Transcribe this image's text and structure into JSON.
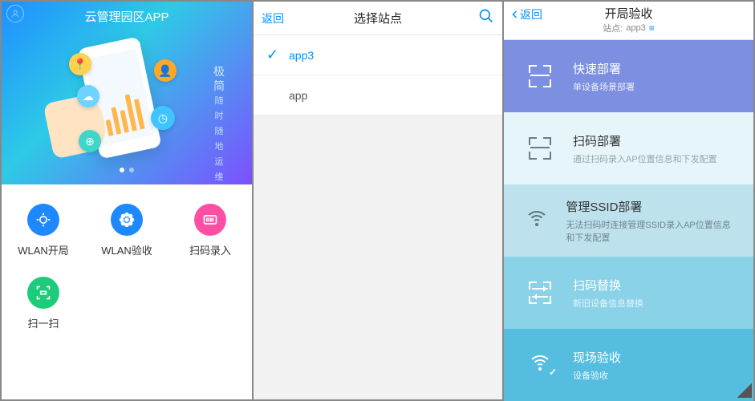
{
  "panel1": {
    "title": "云管理园区APP",
    "slogan_big": "极\n简",
    "slogan_small": "随\n时\n随\n地\n运\n维",
    "tiles": [
      {
        "label": "WLAN开局",
        "icon": "scan-icon",
        "color": "ic-blue"
      },
      {
        "label": "WLAN验收",
        "icon": "flower-icon",
        "color": "ic-blue2"
      },
      {
        "label": "扫码录入",
        "icon": "barcode-icon",
        "color": "ic-pink"
      },
      {
        "label": "扫一扫",
        "icon": "qr-icon",
        "color": "ic-green"
      }
    ]
  },
  "panel2": {
    "back": "返回",
    "title": "选择站点",
    "items": [
      {
        "name": "app3",
        "selected": true
      },
      {
        "name": "app",
        "selected": false
      }
    ]
  },
  "panel3": {
    "back": "返回",
    "title": "开局验收",
    "subtitle_prefix": "站点:",
    "subtitle_site": "app3",
    "cards": [
      {
        "title": "快速部署",
        "sub": "单设备场景部署"
      },
      {
        "title": "扫码部署",
        "sub": "通过扫码录入AP位置信息和下发配置"
      },
      {
        "title": "管理SSID部署",
        "sub": "无法扫码时连接管理SSID录入AP位置信息和下发配置"
      },
      {
        "title": "扫码替换",
        "sub": "新旧设备信息替换"
      },
      {
        "title": "现场验收",
        "sub": "设备验收"
      }
    ]
  }
}
